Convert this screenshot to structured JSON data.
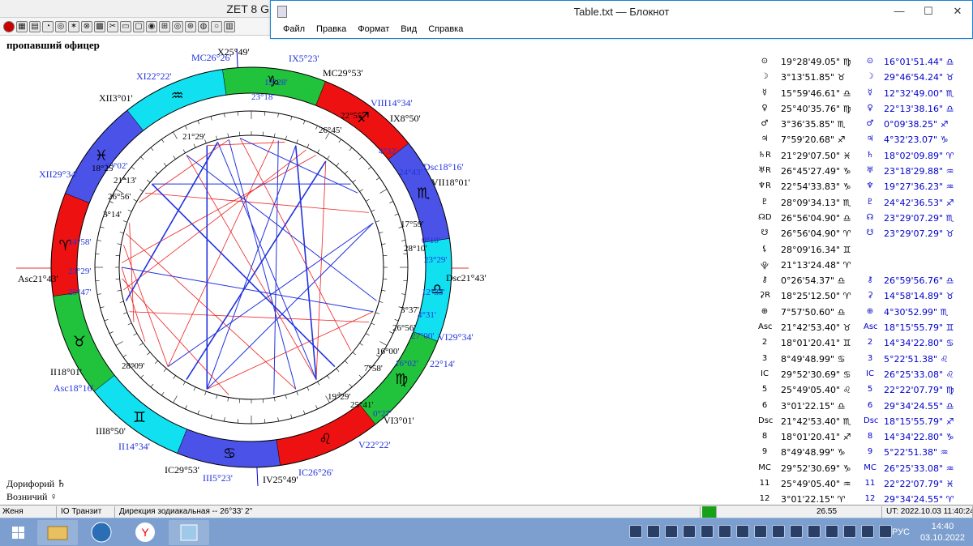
{
  "zet_window": {
    "title_fragment": "ZET 8 G",
    "chart_title": "пропавший офицер"
  },
  "notepad": {
    "title": "Table.txt — Блокнот",
    "menu": [
      "Файл",
      "Правка",
      "Формат",
      "Вид",
      "Справка"
    ],
    "min": "—",
    "max": "☐",
    "close": "✕"
  },
  "chart": {
    "angle_labels": [
      {
        "id": "mc",
        "text": "MC26°26'"
      },
      {
        "id": "c10",
        "text": "X25°49'"
      },
      {
        "id": "c9",
        "text": "IX5°23'"
      },
      {
        "id": "mc2",
        "text": "MC29°53'"
      },
      {
        "id": "c8",
        "text": "VIII14°34'"
      },
      {
        "id": "c8b",
        "text": "IX8°50'"
      },
      {
        "id": "dsc",
        "text": "Dsc18°16'"
      },
      {
        "id": "c7",
        "text": "VII18°01'"
      },
      {
        "id": "dsc2",
        "text": "Dsc21°43'"
      },
      {
        "id": "c6",
        "text": "VI29°34'"
      },
      {
        "id": "c6b",
        "text": "22°14'"
      },
      {
        "id": "c5",
        "text": "VI3°01'"
      },
      {
        "id": "c5b",
        "text": "V22°22'"
      },
      {
        "id": "ic",
        "text": "IC26°26'"
      },
      {
        "id": "c4",
        "text": "IV25°49'"
      },
      {
        "id": "c3",
        "text": "III5°23'"
      },
      {
        "id": "ic2",
        "text": "IC29°53'"
      },
      {
        "id": "c2",
        "text": "II14°34'"
      },
      {
        "id": "c2b",
        "text": "III8°50'"
      },
      {
        "id": "asc",
        "text": "Asc18°16'"
      },
      {
        "id": "c1",
        "text": "II18°01'"
      },
      {
        "id": "asc2",
        "text": "Asc21°43'"
      },
      {
        "id": "c12",
        "text": "XII29°34'"
      },
      {
        "id": "c12b",
        "text": "XII3°01'"
      },
      {
        "id": "c11",
        "text": "XI22°22'"
      }
    ],
    "planet_labels": [
      {
        "id": "p1",
        "text": "19°28'"
      },
      {
        "id": "p2",
        "text": "23°18'"
      },
      {
        "id": "p3",
        "text": "22°55'"
      },
      {
        "id": "p4",
        "text": "26°45'"
      },
      {
        "id": "p5",
        "text": "4°32'"
      },
      {
        "id": "p6",
        "text": "24°43'"
      },
      {
        "id": "p7",
        "text": "21°29'"
      },
      {
        "id": "p8",
        "text": "18°02'"
      },
      {
        "id": "p9",
        "text": "21°13'"
      },
      {
        "id": "p10",
        "text": "26°56'"
      },
      {
        "id": "p11",
        "text": "3°14'"
      },
      {
        "id": "p12",
        "text": "14°58'"
      },
      {
        "id": "p13",
        "text": "23°29'"
      },
      {
        "id": "p14",
        "text": "29°47'"
      },
      {
        "id": "p15",
        "text": "17°59'"
      },
      {
        "id": "p16",
        "text": "0°10'"
      },
      {
        "id": "p17",
        "text": "28°10'"
      },
      {
        "id": "p18",
        "text": "23°29'"
      },
      {
        "id": "p19",
        "text": "12°33'"
      },
      {
        "id": "p20",
        "text": "3°37'"
      },
      {
        "id": "p21",
        "text": "4°31'"
      },
      {
        "id": "p22",
        "text": "26°56'"
      },
      {
        "id": "p23",
        "text": "27°00'"
      },
      {
        "id": "p24",
        "text": "16°00'"
      },
      {
        "id": "p25",
        "text": "16°02'"
      },
      {
        "id": "p26",
        "text": "7°58'"
      },
      {
        "id": "p27",
        "text": "19°29'"
      },
      {
        "id": "p28",
        "text": "25°41'"
      },
      {
        "id": "p29",
        "text": "0°27'"
      },
      {
        "id": "p30",
        "text": "28°09'"
      },
      {
        "id": "p31",
        "text": "18°25'"
      }
    ]
  },
  "table": [
    {
      "g1": "⊙",
      "v1": "19°28'49.05\" ♍",
      "g2": "⊙",
      "v2": "16°01'51.44\" ♎"
    },
    {
      "g1": "☽",
      "v1": "3°13'51.85\" ♉",
      "g2": "☽",
      "v2": "29°46'54.24\" ♉"
    },
    {
      "g1": "☿",
      "v1": "15°59'46.61\" ♎",
      "g2": "☿",
      "v2": "12°32'49.00\" ♏"
    },
    {
      "g1": "♀",
      "v1": "25°40'35.76\" ♍",
      "g2": "♀",
      "v2": "22°13'38.16\" ♎"
    },
    {
      "g1": "♂",
      "v1": "3°36'35.85\" ♏",
      "g2": "♂",
      "v2": "0°09'38.25\" ♐"
    },
    {
      "g1": "♃",
      "v1": "7°59'20.68\" ♐",
      "g2": "♃",
      "v2": "4°32'23.07\" ♑"
    },
    {
      "g1": "♄R",
      "v1": "21°29'07.50\" ♓",
      "g2": "♄",
      "v2": "18°02'09.89\" ♈"
    },
    {
      "g1": "♅R",
      "v1": "26°45'27.49\" ♑",
      "g2": "♅",
      "v2": "23°18'29.88\" ♒"
    },
    {
      "g1": "♆R",
      "v1": "22°54'33.83\" ♑",
      "g2": "♆",
      "v2": "19°27'36.23\" ♒"
    },
    {
      "g1": "♇",
      "v1": "28°09'34.13\" ♏",
      "g2": "♇",
      "v2": "24°42'36.53\" ♐"
    },
    {
      "g1": "☊D",
      "v1": "26°56'04.90\" ♎",
      "g2": "☊",
      "v2": "23°29'07.29\" ♏"
    },
    {
      "g1": "☋",
      "v1": "26°56'04.90\" ♈",
      "g2": "☋",
      "v2": "23°29'07.29\" ♉"
    },
    {
      "g1": "⚸",
      "v1": "28°09'16.34\" ♊",
      "g2": "",
      "v2": ""
    },
    {
      "g1": "⯓",
      "v1": "21°13'24.48\" ♈",
      "g2": "",
      "v2": ""
    },
    {
      "g1": "⚷",
      "v1": "0°26'54.37\" ♎",
      "g2": "⚷",
      "v2": "26°59'56.76\" ♎"
    },
    {
      "g1": "⚳R",
      "v1": "18°25'12.50\" ♈",
      "g2": "⚳",
      "v2": "14°58'14.89\" ♉"
    },
    {
      "g1": "⊕",
      "v1": "7°57'50.60\" ♎",
      "g2": "⊕",
      "v2": "4°30'52.99\" ♏"
    },
    {
      "g1": "Asc",
      "v1": "21°42'53.40\" ♉",
      "g2": "Asc",
      "v2": "18°15'55.79\" ♊"
    },
    {
      "g1": "2",
      "v1": "18°01'20.41\" ♊",
      "g2": "2",
      "v2": "14°34'22.80\" ♋"
    },
    {
      "g1": "3",
      "v1": "8°49'48.99\" ♋",
      "g2": "3",
      "v2": "5°22'51.38\" ♌"
    },
    {
      "g1": "IC",
      "v1": "29°52'30.69\" ♋",
      "g2": "IC",
      "v2": "26°25'33.08\" ♌"
    },
    {
      "g1": "5",
      "v1": "25°49'05.40\" ♌",
      "g2": "5",
      "v2": "22°22'07.79\" ♍"
    },
    {
      "g1": "6",
      "v1": "3°01'22.15\" ♎",
      "g2": "6",
      "v2": "29°34'24.55\" ♎"
    },
    {
      "g1": "Dsc",
      "v1": "21°42'53.40\" ♏",
      "g2": "Dsc",
      "v2": "18°15'55.79\" ♐"
    },
    {
      "g1": "8",
      "v1": "18°01'20.41\" ♐",
      "g2": "8",
      "v2": "14°34'22.80\" ♑"
    },
    {
      "g1": "9",
      "v1": "8°49'48.99\" ♑",
      "g2": "9",
      "v2": "5°22'51.38\" ♒"
    },
    {
      "g1": "MC",
      "v1": "29°52'30.69\" ♑",
      "g2": "MC",
      "v2": "26°25'33.08\" ♒"
    },
    {
      "g1": "11",
      "v1": "25°49'05.40\" ♒",
      "g2": "11",
      "v2": "22°22'07.79\" ♓"
    },
    {
      "g1": "12",
      "v1": "3°01'22.15\" ♈",
      "g2": "12",
      "v2": "29°34'24.55\" ♈"
    }
  ],
  "footer": {
    "line1": "Дорифорий ♄",
    "line2": "Возничий ♀"
  },
  "statusbar": {
    "name": "Женя",
    "mode": "IO Транзит",
    "direction": "Дирекция зодиакальная -- 26°33' 2\"",
    "value": "26.55",
    "ut": "UT: 2022.10.03 11:40:24"
  },
  "taskbar": {
    "lang": "РУС",
    "time": "14:40",
    "date": "03.10.2022"
  }
}
